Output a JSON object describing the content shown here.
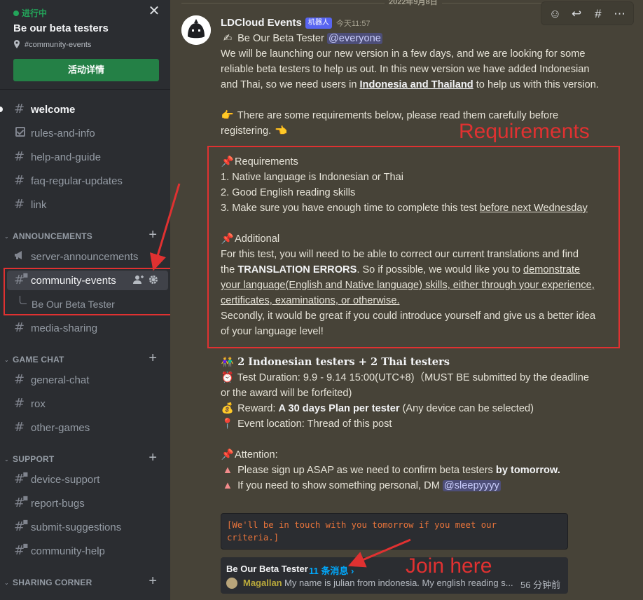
{
  "event": {
    "status": "进行中",
    "title": "Be our beta testers",
    "location": "#community-events",
    "details_button": "活动详情"
  },
  "sidebar": {
    "channels_top": [
      {
        "label": "welcome"
      },
      {
        "label": "rules-and-info"
      },
      {
        "label": "help-and-guide"
      },
      {
        "label": "faq-regular-updates"
      },
      {
        "label": "link"
      }
    ],
    "announcements": {
      "category": "ANNOUNCEMENTS",
      "items": [
        {
          "label": "server-announcements"
        },
        {
          "label": "community-events"
        }
      ],
      "thread": "Be Our Beta Tester",
      "after": {
        "label": "media-sharing"
      }
    },
    "game_chat": {
      "category": "GAME CHAT",
      "items": [
        {
          "label": "general-chat"
        },
        {
          "label": "rox"
        },
        {
          "label": "other-games"
        }
      ]
    },
    "support": {
      "category": "SUPPORT",
      "items": [
        {
          "label": "device-support"
        },
        {
          "label": "report-bugs"
        },
        {
          "label": "submit-suggestions"
        },
        {
          "label": "community-help"
        }
      ]
    },
    "sharing": {
      "category": "SHARING CORNER"
    }
  },
  "chat": {
    "date": "2022年9月8日",
    "author": "LDCloud Events",
    "bot_tag": "机器人",
    "time": "今天11:57",
    "title_line": "Be Our Beta Tester",
    "everyone": "@everyone",
    "intro": [
      "We will be launching our new version in a few days, and we are looking for some",
      "reliable beta testers to help us out. In this new version we have added Indonesian",
      "and Thai, so we need users in "
    ],
    "intro_bold": "Indonesia and Thailand",
    "intro_end": " to help us with this version.",
    "req_intro_1": "There are some requirements below, please read them carefully before",
    "req_intro_2": "registering.",
    "requirements_title": "Requirements",
    "req_1": "1. Native language is Indonesian or Thai",
    "req_2": "2. Good English reading skills",
    "req_3": "3. Make sure you have enough time to complete this test ",
    "req_3_ul": "before next Wednesday",
    "additional_title": "Additional",
    "add_1": "For this test, you will need to be able to correct our current translations and find",
    "add_2a": "the ",
    "add_2b": "TRANSLATION ERRORS",
    "add_2c": ". So if possible, we would like you to ",
    "add_2d": "demonstrate ",
    "add_3": "your language(English and Native language) skills, either through your experience,",
    "add_4": "certificates, examinations, or otherwise. ",
    "add_5": "Secondly, it would be great if you could introduce yourself and give us a better idea",
    "add_6": "of your language level!",
    "testers": "2 Indonesian testers + 2 Thai testers",
    "duration_1": "Test Duration: 9.9 - 9.14 15:00(UTC+8)（MUST BE submitted by the deadline",
    "duration_2": "or the award will be forfeited)",
    "reward_a": "Reward: ",
    "reward_b": "A 30 days Plan per tester",
    "reward_c": " (Any device can be selected)",
    "location": "Event location: Thread of this post",
    "attention": "Attention:",
    "att_1a": "Please sign up ASAP as we need to confirm beta testers ",
    "att_1b": "by tomorrow.",
    "att_2": "If you need to show something personal, DM ",
    "att_mention": "@sleepyyyy",
    "code_1": "[We'll be in touch with you tomorrow if you meet our",
    "code_2": "criteria.]",
    "thread_card": {
      "name": "Be Our Beta Tester",
      "count": "11 条消息 ›",
      "user": "Magallan",
      "message": "My name is julian from indonesia. My english reading s...",
      "time": "56 分钟前"
    }
  },
  "annotations": {
    "requirements": "Requirements",
    "join": "Join here"
  },
  "colors": {
    "sidebar_bg": "#2b2d31",
    "chat_bg": "#474338",
    "accent_green": "#248046",
    "annotation_red": "#e03131",
    "link_blue": "#00a8fc"
  }
}
